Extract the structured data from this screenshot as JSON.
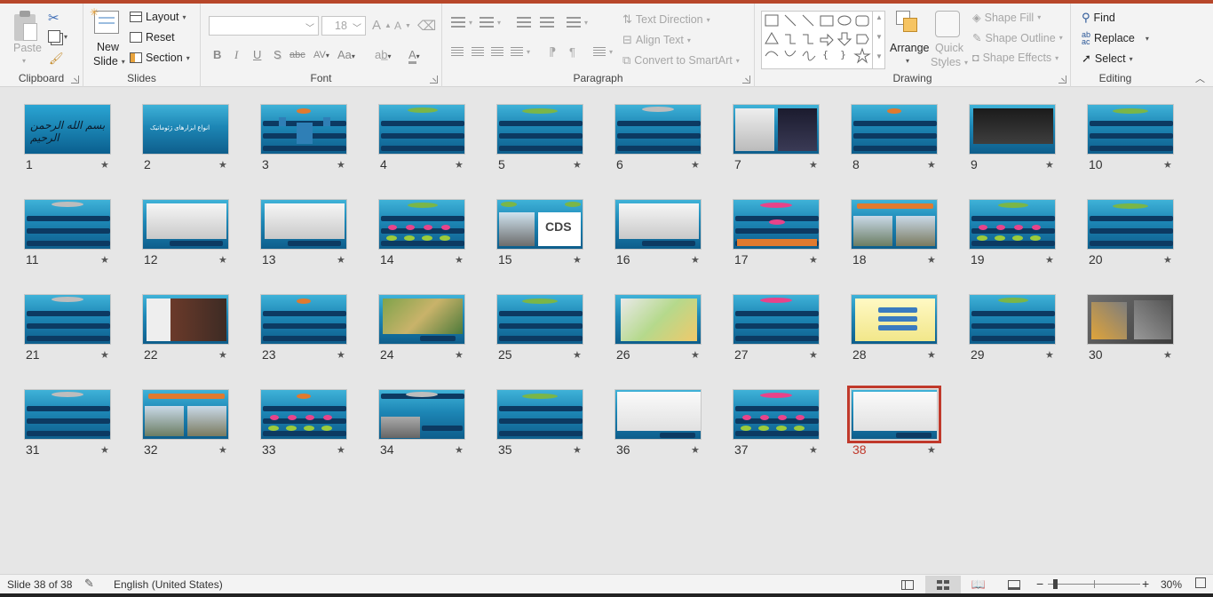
{
  "ribbon": {
    "clipboard": {
      "label": "Clipboard",
      "paste": "Paste"
    },
    "slides": {
      "label": "Slides",
      "new_slide_1": "New",
      "new_slide_2": "Slide",
      "layout": "Layout",
      "reset": "Reset",
      "section": "Section"
    },
    "font": {
      "label": "Font",
      "size_value": "18",
      "grow": "A",
      "shrink": "A",
      "bold": "B",
      "italic": "I",
      "underline": "U",
      "shadow": "S",
      "strike": "abc",
      "spacing": "AV",
      "case": "Aa",
      "color": "A"
    },
    "paragraph": {
      "label": "Paragraph",
      "text_direction": "Text Direction",
      "align_text": "Align Text",
      "convert_smartart": "Convert to SmartArt"
    },
    "drawing": {
      "label": "Drawing",
      "arrange": "Arrange",
      "quick_styles_1": "Quick",
      "quick_styles_2": "Styles",
      "shape_fill": "Shape Fill",
      "shape_outline": "Shape Outline",
      "shape_effects": "Shape Effects"
    },
    "editing": {
      "label": "Editing",
      "find": "Find",
      "replace": "Replace",
      "select": "Select"
    }
  },
  "slides": [
    {
      "n": "1"
    },
    {
      "n": "2"
    },
    {
      "n": "3"
    },
    {
      "n": "4"
    },
    {
      "n": "5"
    },
    {
      "n": "6"
    },
    {
      "n": "7"
    },
    {
      "n": "8"
    },
    {
      "n": "9"
    },
    {
      "n": "10"
    },
    {
      "n": "11"
    },
    {
      "n": "12"
    },
    {
      "n": "13"
    },
    {
      "n": "14"
    },
    {
      "n": "15"
    },
    {
      "n": "16"
    },
    {
      "n": "17"
    },
    {
      "n": "18"
    },
    {
      "n": "19"
    },
    {
      "n": "20"
    },
    {
      "n": "21"
    },
    {
      "n": "22"
    },
    {
      "n": "23"
    },
    {
      "n": "24"
    },
    {
      "n": "25"
    },
    {
      "n": "26"
    },
    {
      "n": "27"
    },
    {
      "n": "28"
    },
    {
      "n": "29"
    },
    {
      "n": "30"
    },
    {
      "n": "31"
    },
    {
      "n": "32"
    },
    {
      "n": "33"
    },
    {
      "n": "34"
    },
    {
      "n": "35"
    },
    {
      "n": "36"
    },
    {
      "n": "37"
    },
    {
      "n": "38"
    }
  ],
  "selected_slide": "38",
  "slide_texts": {
    "slide1_calligraphy": "بسم الله الرحمن الرحيم",
    "slide2_title": "انواع ابزارهای ژئوماتیک"
  },
  "slide15_logo": "CDS",
  "status": {
    "slide_info": "Slide 38 of 38",
    "language": "English (United States)",
    "zoom": "30%"
  },
  "colors": {
    "accent": "#b7472a",
    "selection": "#c0392b",
    "slide_bg": "#1d86b5",
    "text_bar": "#0c3a62"
  }
}
